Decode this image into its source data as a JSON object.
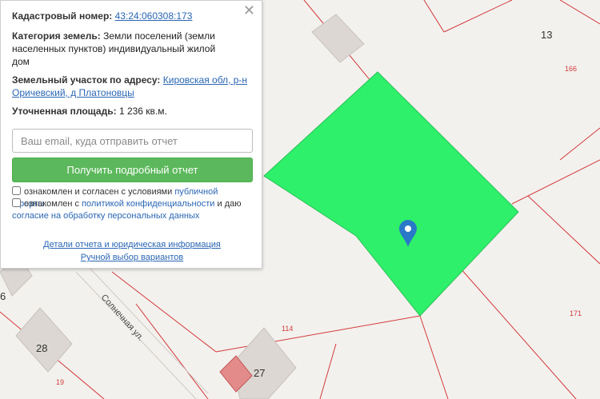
{
  "map": {
    "parcel_numbers": [
      "13",
      "166",
      "171",
      "114",
      "19"
    ],
    "house_numbers": [
      "28",
      "27",
      "6"
    ],
    "street": "Солнечная ул.",
    "colors": {
      "background": "#f3f1ee",
      "selected_parcel": "#2ef06a",
      "parcel_border": "#d23b3b",
      "building": "#dcd7d2",
      "marker": "#2a78c8"
    },
    "icons": [
      "map-pin-icon"
    ]
  },
  "popup": {
    "cadastral_label": "Кадастровый номер:",
    "cadastral_value": "43:24:060308:173",
    "category_label": "Категория земель:",
    "category_value": "Земли поселений (земли населенных пунктов) индивидуальный жилой дом",
    "address_label": "Земельный участок по адресу:",
    "address_value": "Кировская обл, р-н Оричевский, д Платоновцы",
    "area_label": "Уточненная площадь:",
    "area_value": "1 236 кв.м.",
    "email_placeholder": "Ваш email, куда отправить отчет",
    "report_button": "Получить подробный отчет",
    "check1_text": "ознакомлен и согласен с условиями",
    "check1_link": "публичной оферты",
    "check2_text": "ознакомлен с",
    "check2_link": "политикой конфиденциальности",
    "check2_mid": "и даю",
    "check2_link2": "согласие на обработку персональных данных",
    "details_link": "Детали отчета и юридическая информация",
    "manual_link": "Ручной выбор вариантов",
    "close_glyph": "✕"
  }
}
